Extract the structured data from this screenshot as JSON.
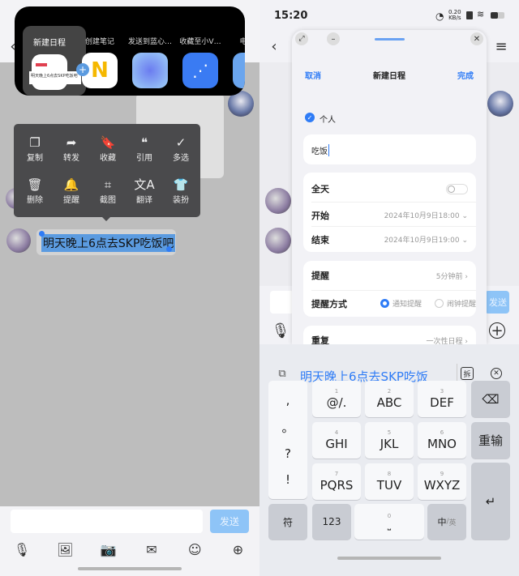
{
  "left": {
    "share_panel": {
      "items": [
        {
          "label": "新建日程",
          "icon": "calendar-icon",
          "preview": "明天晚上6点去SKP吃饭吧"
        },
        {
          "label": "创建笔记",
          "icon": "notes-icon"
        },
        {
          "label": "发送到蓝心…",
          "icon": "bluelm-icon"
        },
        {
          "label": "收藏至小V…",
          "icon": "share-node-icon"
        },
        {
          "label": "电子…",
          "icon": "mail-icon"
        }
      ]
    },
    "context_menu": {
      "items": [
        {
          "label": "复制",
          "icon": "copy-icon",
          "glyph": "❐"
        },
        {
          "label": "转发",
          "icon": "forward-icon",
          "glyph": "➦"
        },
        {
          "label": "收藏",
          "icon": "bookmark-icon",
          "glyph": "🔖"
        },
        {
          "label": "引用",
          "icon": "quote-icon",
          "glyph": "❝"
        },
        {
          "label": "多选",
          "icon": "check-circle-icon",
          "glyph": "✓"
        },
        {
          "label": "删除",
          "icon": "trash-icon",
          "glyph": "🗑"
        },
        {
          "label": "提醒",
          "icon": "bell-icon",
          "glyph": "🔔"
        },
        {
          "label": "截图",
          "icon": "crop-icon",
          "glyph": "⌗"
        },
        {
          "label": "翻译",
          "icon": "translate-icon",
          "glyph": "文A"
        },
        {
          "label": "装扮",
          "icon": "shirt-icon",
          "glyph": "👕"
        }
      ]
    },
    "message": "明天晚上6点去SKP吃饭吧",
    "send_label": "发送",
    "input_placeholder": "",
    "toolbar": [
      "mic-icon",
      "image-icon",
      "camera-icon",
      "red-packet-icon",
      "emoji-icon",
      "plus-icon"
    ]
  },
  "right": {
    "status": {
      "time": "15:20",
      "speed": "0.20",
      "speed_unit": "KB/s"
    },
    "window": {
      "cancel": "取消",
      "title": "新建日程",
      "done": "完成",
      "calendar": "个人",
      "title_value": "吃饭",
      "all_day": {
        "label": "全天",
        "on": false
      },
      "start": {
        "label": "开始",
        "value": "2024年10月9日18:00"
      },
      "end": {
        "label": "结束",
        "value": "2024年10月9日19:00"
      },
      "reminder": {
        "label": "提醒",
        "value": "5分钟前"
      },
      "reminder_mode": {
        "label": "提醒方式",
        "options": [
          "通知提醒",
          "闹钟提醒"
        ],
        "selected": "通知提醒"
      },
      "repeat": {
        "label": "重复",
        "value": "一次性日程"
      }
    },
    "send_label": "发送",
    "keyboard": {
      "candidate": "明天晚上6点去SKP吃饭",
      "split_label": "拆",
      "punct": [
        ",",
        "。",
        "?",
        "!"
      ],
      "keys": [
        {
          "num": "1",
          "label": "@/."
        },
        {
          "num": "2",
          "label": "ABC"
        },
        {
          "num": "3",
          "label": "DEF"
        },
        {
          "num": "4",
          "label": "GHI"
        },
        {
          "num": "5",
          "label": "JKL"
        },
        {
          "num": "6",
          "label": "MNO"
        },
        {
          "num": "7",
          "label": "PQRS"
        },
        {
          "num": "8",
          "label": "TUV"
        },
        {
          "num": "9",
          "label": "WXYZ"
        }
      ],
      "retype": "重输",
      "symbols": "符",
      "numbers": "123",
      "space_num": "0",
      "lang": "中",
      "lang_alt": "英"
    },
    "accent": "#2f7cf6"
  }
}
